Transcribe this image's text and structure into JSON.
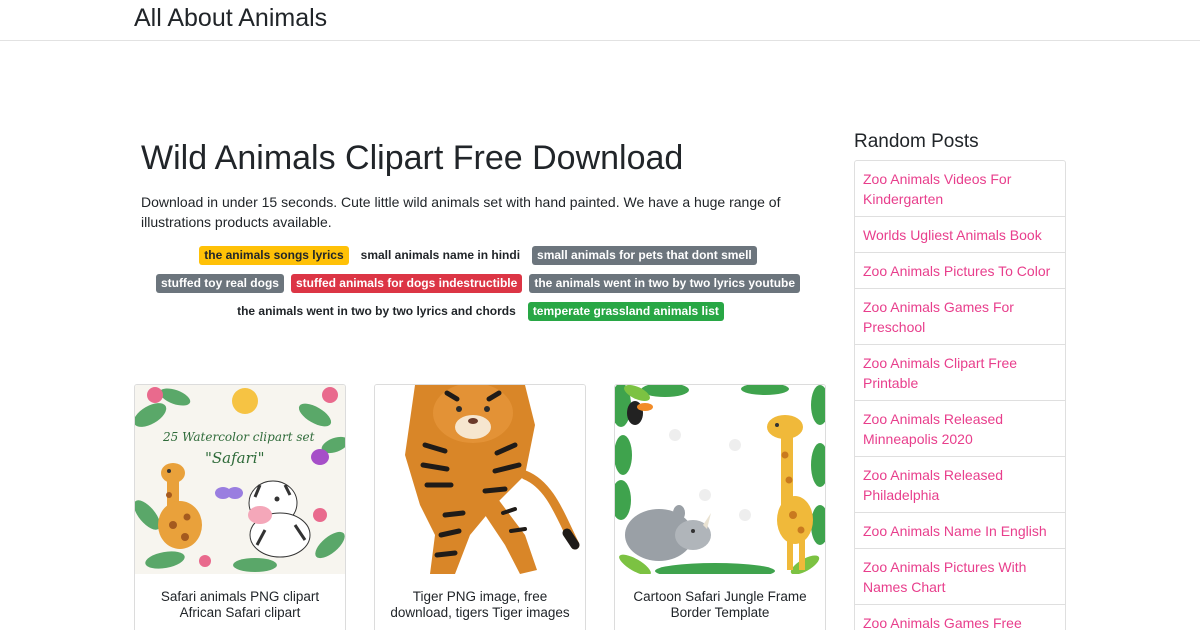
{
  "site": {
    "brand": "All About Animals"
  },
  "article": {
    "title": "Wild Animals Clipart Free Download",
    "intro": "Download in under 15 seconds. Cute little wild animals set with hand painted. We have a huge range of illustrations products available."
  },
  "tags": [
    {
      "label": "the animals songs lyrics",
      "color": "#ffc107"
    },
    {
      "label": "small animals name in hindi",
      "color": "#ffffff"
    },
    {
      "label": "small animals for pets that dont smell",
      "color": "#6c757d"
    },
    {
      "label": "stuffed toy real dogs",
      "color": "#6c757d"
    },
    {
      "label": "stuffed animals for dogs indestructible",
      "color": "#dc3545"
    },
    {
      "label": "the animals went in two by two lyrics youtube",
      "color": "#6c757d"
    },
    {
      "label": "the animals went in two by two lyrics and chords",
      "color": "#ffffff"
    },
    {
      "label": "temperate grassland animals list",
      "color": "#28a745"
    }
  ],
  "cards": [
    {
      "caption": "Safari animals PNG clipart African Safari clipart",
      "image": "safari-animals-watercolor-image",
      "thumb_title": "25 Watercolor clipart set \"Safari\""
    },
    {
      "caption": "Tiger PNG image, free download, tigers Tiger images",
      "image": "tiger-image"
    },
    {
      "caption": "Cartoon Safari Jungle Frame Border Template",
      "image": "jungle-frame-image"
    }
  ],
  "sidebar": {
    "title": "Random Posts",
    "posts": [
      "Zoo Animals Videos For Kindergarten",
      "Worlds Ugliest Animals Book",
      "Zoo Animals Pictures To Color",
      "Zoo Animals Games For Preschool",
      "Zoo Animals Clipart Free Printable",
      "Zoo Animals Released Minneapolis 2020",
      "Zoo Animals Released Philadelphia",
      "Zoo Animals Name In English",
      "Zoo Animals Pictures With Names Chart",
      "Zoo Animals Games Free"
    ]
  },
  "colors": {
    "link": "#e83e8c",
    "text": "#212529",
    "border": "#dfdfdf"
  }
}
